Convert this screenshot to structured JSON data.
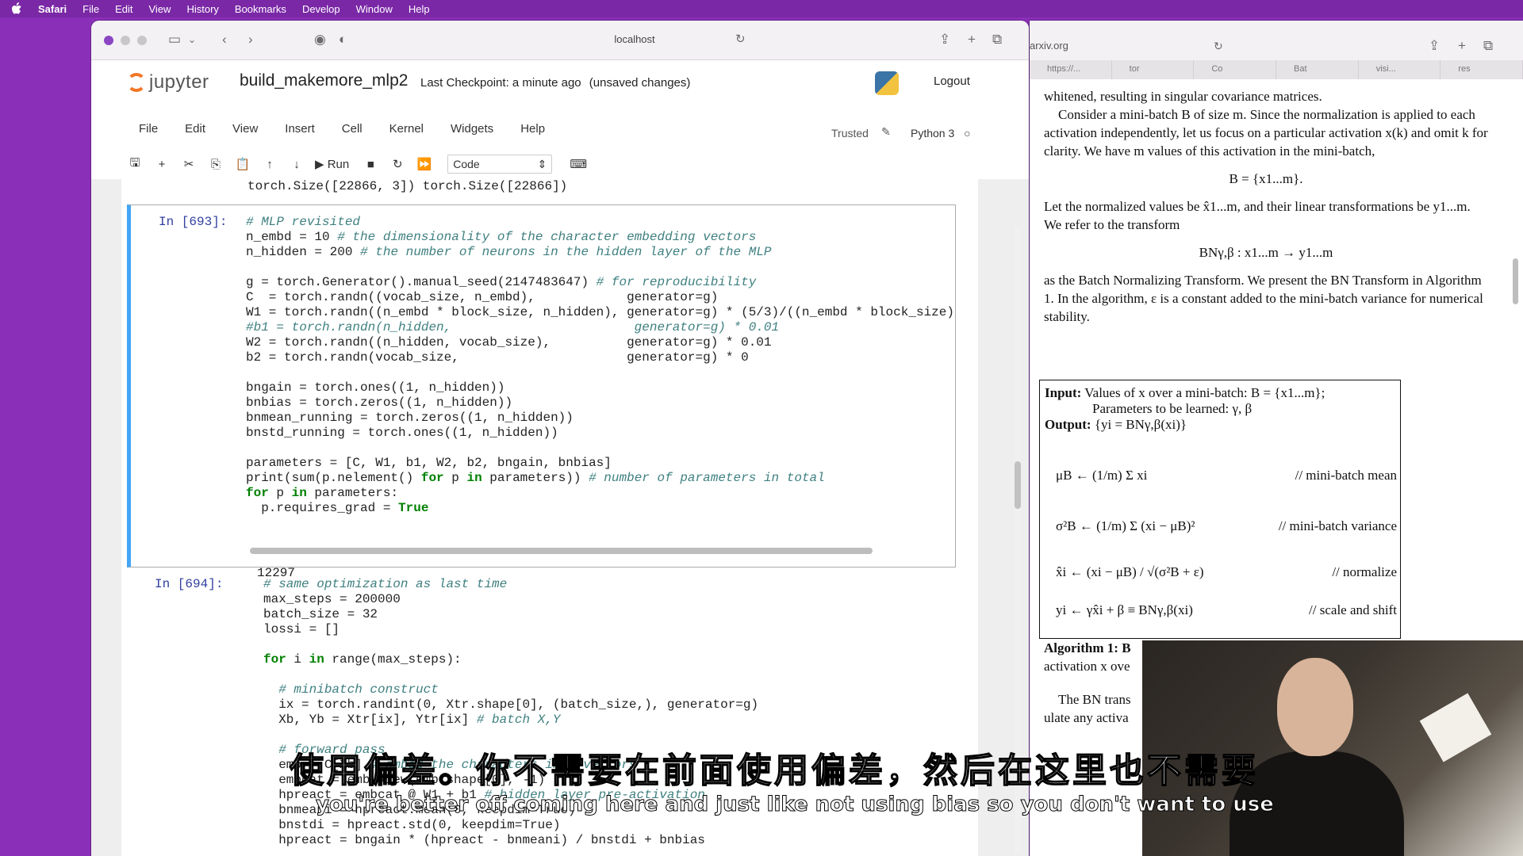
{
  "menubar": {
    "apple": "",
    "items": [
      "Safari",
      "File",
      "Edit",
      "View",
      "History",
      "Bookmarks",
      "Develop",
      "Window",
      "Help"
    ]
  },
  "left_window": {
    "url": "localhost",
    "jupyter": {
      "logo_text": "jupyter",
      "notebook_name": "build_makemore_mlp2",
      "checkpoint": "Last Checkpoint: a minute ago",
      "unsaved": "(unsaved changes)",
      "logout": "Logout",
      "menu": [
        "File",
        "Edit",
        "View",
        "Insert",
        "Cell",
        "Kernel",
        "Widgets",
        "Help"
      ],
      "trusted": "Trusted",
      "kernel": "Python 3",
      "run_label": "Run",
      "cell_type": "Code"
    },
    "top_output_line": "torch.Size([22866, 3]) torch.Size([22866])",
    "cell1": {
      "prompt": "In [693]:",
      "output": "12297"
    },
    "cell2": {
      "prompt": "In [694]:"
    }
  },
  "right_window": {
    "url": "arxiv.org",
    "tabs": [
      "https://...",
      "tor",
      "Co",
      "Bat",
      "visi...",
      "res"
    ],
    "para1": "whitened, resulting in singular covariance matrices.",
    "para2": "Consider a mini-batch B of size m. Since the normalization is applied to each activation independently, let us focus on a particular activation x(k) and omit k for clarity. We have m values of this activation in the mini-batch,",
    "eq1": "B = {x1...m}.",
    "para3": "Let the normalized values be x̂1...m, and their linear transformations be y1...m. We refer to the transform",
    "eq2": "BNγ,β : x1...m → y1...m",
    "para4": "as the Batch Normalizing Transform. We present the BN Transform in Algorithm 1. In the algorithm, ε is a constant added to the mini-batch variance for numerical stability.",
    "algo": {
      "input": "Input:",
      "input_text": "Values of x over a mini-batch: B = {x1...m};",
      "params": "Parameters to be learned: γ, β",
      "output": "Output:",
      "output_text": "{yi = BNγ,β(xi)}",
      "rows": [
        {
          "eq": "μB ← (1/m) Σ xi",
          "comment": "// mini-batch mean"
        },
        {
          "eq": "σ²B ← (1/m) Σ (xi − μB)²",
          "comment": "// mini-batch variance"
        },
        {
          "eq": "x̂i ← (xi − μB) / √(σ²B + ε)",
          "comment": "// normalize"
        },
        {
          "eq": "yi ← γx̂i + β ≡ BNγ,β(xi)",
          "comment": "// scale and shift"
        }
      ]
    },
    "algo_caption": "Algorithm 1: B",
    "algo_caption2": "activation x ove",
    "para5": "The BN trans",
    "para5b": "ulate any activa"
  },
  "subtitles": {
    "chinese": "使用偏差。你不需要在前面使用偏差，然后在这里也不需要",
    "english": "you're better off coming here and just like not using bias so you don't want to use"
  }
}
